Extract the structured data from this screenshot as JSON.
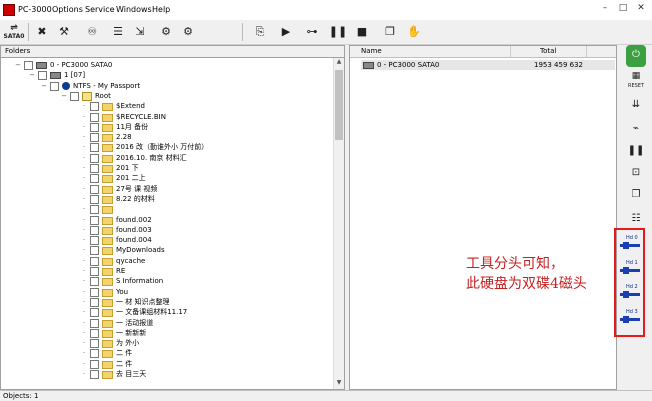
{
  "window": {
    "title": "PC-3000",
    "menu": [
      "Options",
      "Service",
      "Windows",
      "Help"
    ]
  },
  "toolbar": {
    "sata_label": "SATA0",
    "icons": [
      "tool-icon",
      "wrench-icon",
      "binoculars-icon",
      "stack-icon",
      "export-icon",
      "gear-icon",
      "gear-pair-icon",
      "exit-icon",
      "play-icon",
      "tree-icon",
      "pause-icon",
      "stop-icon",
      "copy-icon",
      "hand-icon"
    ]
  },
  "folders_pane": {
    "header": "Folders",
    "nodes": [
      {
        "level": 0,
        "label": "0 - PC3000 SATA0",
        "icon": "disk"
      },
      {
        "level": 1,
        "label": "1 [07]",
        "icon": "disk"
      },
      {
        "level": 2,
        "label": "NTFS - My Passport",
        "icon": "info"
      },
      {
        "level": 3,
        "label": "Root",
        "icon": "root"
      },
      {
        "level": 4,
        "label": "$Extend",
        "icon": "folder"
      },
      {
        "level": 4,
        "label": "$RECYCLE.BIN",
        "icon": "folder"
      },
      {
        "level": 4,
        "label": "11月              备份",
        "icon": "folder"
      },
      {
        "level": 4,
        "label": "2.28",
        "icon": "folder"
      },
      {
        "level": 4,
        "label": "2016          改（勤谁外小 万付前）",
        "icon": "folder"
      },
      {
        "level": 4,
        "label": "2016.10.            南京                 材料汇",
        "icon": "folder"
      },
      {
        "level": 4,
        "label": "201                  下",
        "icon": "folder"
      },
      {
        "level": 4,
        "label": "201                  二上",
        "icon": "folder"
      },
      {
        "level": 4,
        "label": "27号               课 视频",
        "icon": "folder"
      },
      {
        "level": 4,
        "label": "8.22              的材料",
        "icon": "folder"
      },
      {
        "level": 4,
        "label": "",
        "icon": "folder"
      },
      {
        "level": 4,
        "label": "found.002",
        "icon": "folder"
      },
      {
        "level": 4,
        "label": "found.003",
        "icon": "folder"
      },
      {
        "level": 4,
        "label": "found.004",
        "icon": "folder"
      },
      {
        "level": 4,
        "label": "MyDownloads",
        "icon": "folder"
      },
      {
        "level": 4,
        "label": "qycache",
        "icon": "folder"
      },
      {
        "level": 4,
        "label": "RE",
        "icon": "folder"
      },
      {
        "level": 4,
        "label": "S                 Information",
        "icon": "folder"
      },
      {
        "level": 4,
        "label": "You",
        "icon": "folder"
      },
      {
        "level": 4,
        "label": "一              材 知识点整理",
        "icon": "folder"
      },
      {
        "level": 4,
        "label": "一             文备课组材料11.17",
        "icon": "folder"
      },
      {
        "level": 4,
        "label": "一               活动报道",
        "icon": "folder"
      },
      {
        "level": 4,
        "label": "一                新新新",
        "icon": "folder"
      },
      {
        "level": 4,
        "label": "为                外小",
        "icon": "folder"
      },
      {
        "level": 4,
        "label": "二                件",
        "icon": "folder"
      },
      {
        "level": 4,
        "label": "二                件",
        "icon": "folder"
      },
      {
        "level": 4,
        "label": "去                目三天",
        "icon": "folder"
      }
    ]
  },
  "list_pane": {
    "columns": {
      "name": "Name",
      "total": "Total"
    },
    "rows": [
      {
        "name": "0 - PC3000 SATA0",
        "total": "1953 459 632"
      }
    ]
  },
  "annotation": {
    "line1": "工具分头可知，",
    "line2": "此硬盘为双碟4磁头",
    "color": "#c62020"
  },
  "side_toolbar": {
    "reset_label": "RESET",
    "hd_labels": [
      "Hd 0",
      "Hd 1",
      "Hd 2",
      "Hd 3"
    ],
    "highlight_color": "#e51b1b"
  },
  "status": {
    "objects": "Objects: 1"
  }
}
